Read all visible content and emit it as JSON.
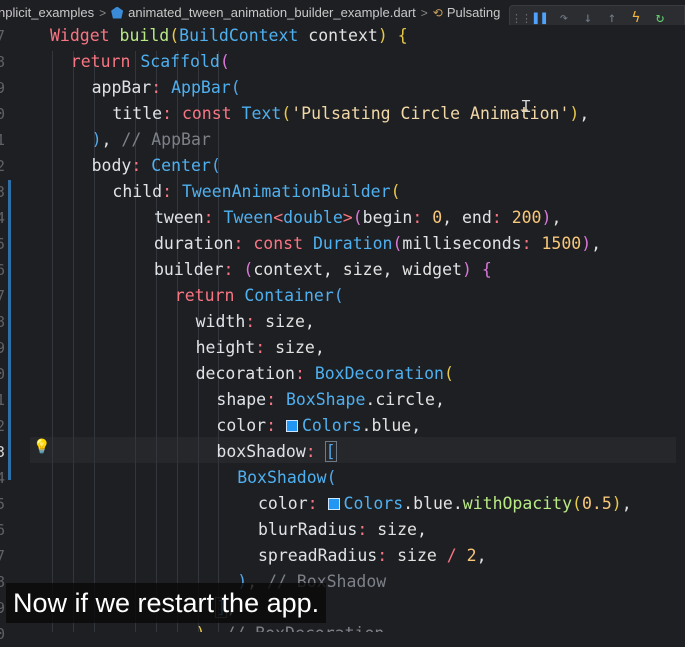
{
  "breadcrumbs": [
    {
      "label": "nplicit_examples",
      "icon": "none"
    },
    {
      "label": "animated_tween_animation_builder_example.dart",
      "icon": "dart-file-icon"
    },
    {
      "label": "Pulsating",
      "icon": "widget-icon"
    }
  ],
  "breadcrumb_separator": ">",
  "debug_toolbar": {
    "buttons": [
      {
        "name": "drag-handle-icon",
        "glyph": "⋮⋮",
        "color": "#6e6e6e"
      },
      {
        "name": "pause-icon",
        "glyph": "❚❚",
        "color": "#4fa3ff"
      },
      {
        "name": "step-over-icon",
        "glyph": "↷",
        "color": "#6e7a88"
      },
      {
        "name": "step-into-icon",
        "glyph": "↓",
        "color": "#6e7a88"
      },
      {
        "name": "step-out-icon",
        "glyph": "↑",
        "color": "#6e7a88"
      },
      {
        "name": "hot-reload-icon",
        "glyph": "ϟ",
        "color": "#f5b73b"
      },
      {
        "name": "hot-restart-icon",
        "glyph": "↻",
        "color": "#5fd16a"
      }
    ]
  },
  "line_numbers": [
    "7",
    "8",
    "9",
    "0",
    "1",
    "2",
    "3",
    "4",
    "5",
    "6",
    "7",
    "8",
    "9",
    "0",
    "1",
    "2",
    "3",
    "4",
    "5",
    "6",
    "7",
    "8",
    "9",
    "0"
  ],
  "active_line_index": 16,
  "code_lines": [
    [
      [
        "kw",
        "Widget "
      ],
      [
        "fn",
        "build"
      ],
      [
        "br1",
        "("
      ],
      [
        "ty",
        "BuildContext"
      ],
      [
        "id",
        " context"
      ],
      [
        "br1",
        ")"
      ],
      [
        "id",
        " "
      ],
      [
        "br1",
        "{"
      ]
    ],
    [
      [
        "kw",
        "return "
      ],
      [
        "ty",
        "Scaffold"
      ],
      [
        "br2",
        "("
      ]
    ],
    [
      [
        "prop",
        "appBar"
      ],
      [
        "kw",
        ": "
      ],
      [
        "ty",
        "AppBar"
      ],
      [
        "br3",
        "("
      ]
    ],
    [
      [
        "prop",
        "title"
      ],
      [
        "kw",
        ": "
      ],
      [
        "kw",
        "const "
      ],
      [
        "ty",
        "Text"
      ],
      [
        "br1",
        "("
      ],
      [
        "str",
        "'Pulsating Circle Animation'"
      ],
      [
        "br1",
        ")"
      ],
      [
        "id",
        ","
      ]
    ],
    [
      [
        "br3",
        ")"
      ],
      [
        "id",
        ", "
      ],
      [
        "cm",
        "// AppBar"
      ]
    ],
    [
      [
        "prop",
        "body"
      ],
      [
        "kw",
        ": "
      ],
      [
        "ty",
        "Center"
      ],
      [
        "br3",
        "("
      ]
    ],
    [
      [
        "prop",
        "child"
      ],
      [
        "kw",
        ": "
      ],
      [
        "ty",
        "TweenAnimationBuilder"
      ],
      [
        "br1",
        "("
      ]
    ],
    [
      [
        "prop",
        "tween"
      ],
      [
        "kw",
        ": "
      ],
      [
        "ty",
        "Tween"
      ],
      [
        "kw",
        "<"
      ],
      [
        "ty",
        "double"
      ],
      [
        "kw",
        ">"
      ],
      [
        "br2",
        "("
      ],
      [
        "prop",
        "begin"
      ],
      [
        "kw",
        ": "
      ],
      [
        "num",
        "0"
      ],
      [
        "id",
        ", "
      ],
      [
        "prop",
        "end"
      ],
      [
        "kw",
        ": "
      ],
      [
        "num",
        "200"
      ],
      [
        "br2",
        ")"
      ],
      [
        "id",
        ","
      ]
    ],
    [
      [
        "prop",
        "duration"
      ],
      [
        "kw",
        ": "
      ],
      [
        "kw",
        "const "
      ],
      [
        "ty",
        "Duration"
      ],
      [
        "br2",
        "("
      ],
      [
        "prop",
        "milliseconds"
      ],
      [
        "kw",
        ": "
      ],
      [
        "num",
        "1500"
      ],
      [
        "br2",
        ")"
      ],
      [
        "id",
        ","
      ]
    ],
    [
      [
        "prop",
        "builder"
      ],
      [
        "kw",
        ": "
      ],
      [
        "br2",
        "("
      ],
      [
        "id",
        "context, size, widget"
      ],
      [
        "br2",
        ")"
      ],
      [
        "id",
        " "
      ],
      [
        "br2",
        "{"
      ]
    ],
    [
      [
        "kw",
        "return "
      ],
      [
        "ty",
        "Container"
      ],
      [
        "br3",
        "("
      ]
    ],
    [
      [
        "prop",
        "width"
      ],
      [
        "kw",
        ": "
      ],
      [
        "id",
        "size,"
      ]
    ],
    [
      [
        "prop",
        "height"
      ],
      [
        "kw",
        ": "
      ],
      [
        "id",
        "size,"
      ]
    ],
    [
      [
        "prop",
        "decoration"
      ],
      [
        "kw",
        ": "
      ],
      [
        "ty",
        "BoxDecoration"
      ],
      [
        "br1",
        "("
      ]
    ],
    [
      [
        "prop",
        "shape"
      ],
      [
        "kw",
        ": "
      ],
      [
        "ty",
        "BoxShape"
      ],
      [
        "id",
        ".circle,"
      ]
    ],
    [
      [
        "prop",
        "color"
      ],
      [
        "kw",
        ": "
      ],
      [
        "swatch",
        ""
      ],
      [
        "ty",
        "Colors"
      ],
      [
        "id",
        ".blue,"
      ]
    ],
    [
      [
        "prop",
        "boxShadow"
      ],
      [
        "kw",
        ": "
      ],
      [
        "cursor",
        "["
      ]
    ],
    [
      [
        "ty",
        "BoxShadow"
      ],
      [
        "br3",
        "("
      ]
    ],
    [
      [
        "prop",
        "color"
      ],
      [
        "kw",
        ": "
      ],
      [
        "swatch",
        ""
      ],
      [
        "ty",
        "Colors"
      ],
      [
        "id",
        ".blue."
      ],
      [
        "fn",
        "withOpacity"
      ],
      [
        "br1",
        "("
      ],
      [
        "num",
        "0.5"
      ],
      [
        "br1",
        ")"
      ],
      [
        "id",
        ","
      ]
    ],
    [
      [
        "prop",
        "blurRadius"
      ],
      [
        "kw",
        ": "
      ],
      [
        "id",
        "size,"
      ]
    ],
    [
      [
        "prop",
        "spreadRadius"
      ],
      [
        "kw",
        ": "
      ],
      [
        "id",
        "size "
      ],
      [
        "kw",
        "/ "
      ],
      [
        "num",
        "2"
      ],
      [
        "id",
        ","
      ]
    ],
    [
      [
        "br3",
        ")"
      ],
      [
        "id",
        ", "
      ],
      [
        "cm",
        "// BoxShadow"
      ]
    ],
    [
      [
        "cursor",
        "]"
      ],
      [
        "id",
        ","
      ]
    ],
    [
      [
        "br1",
        ")"
      ],
      [
        "id",
        ", "
      ],
      [
        "cm",
        "// BoxDecoration"
      ]
    ]
  ],
  "caption": "Now if we restart the app.",
  "colors": {
    "accent": "#4fb0f0",
    "swatch": "#2196f3",
    "keyword": "#f97583"
  }
}
